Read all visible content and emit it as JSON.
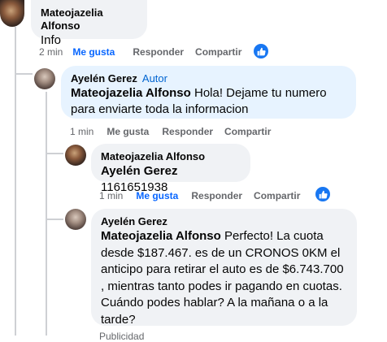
{
  "comments": [
    {
      "author": "Mateojazelia Alfonso",
      "text": "Info",
      "time": "2 min",
      "like": "Me gusta",
      "reply": "Responder",
      "share": "Compartir"
    },
    {
      "author": "Ayelén Gerez",
      "badge": "Autor",
      "mention": "Mateojazelia Alfonso",
      "text": " Hola! Dejame tu numero para enviarte toda la informacion",
      "time": "1 min",
      "like": "Me gusta",
      "reply": "Responder",
      "share": "Compartir"
    },
    {
      "author": "Mateojazelia Alfonso",
      "mention": "Ayelén Gerez",
      "text": " 1161651938",
      "time": "1 min",
      "like": "Me gusta",
      "reply": "Responder",
      "share": "Compartir"
    },
    {
      "author": "Ayelén Gerez",
      "mention": "Mateojazelia Alfonso",
      "text": " Perfecto! La cuota desde $187.467. es de un CRONOS 0KM el anticipo para retirar el auto es de $6.743.700 , mientras tanto podes ir pagando en cuotas. Cuándo podes hablar? A la mañana o a la tarde?",
      "time": "Publicidad"
    }
  ]
}
